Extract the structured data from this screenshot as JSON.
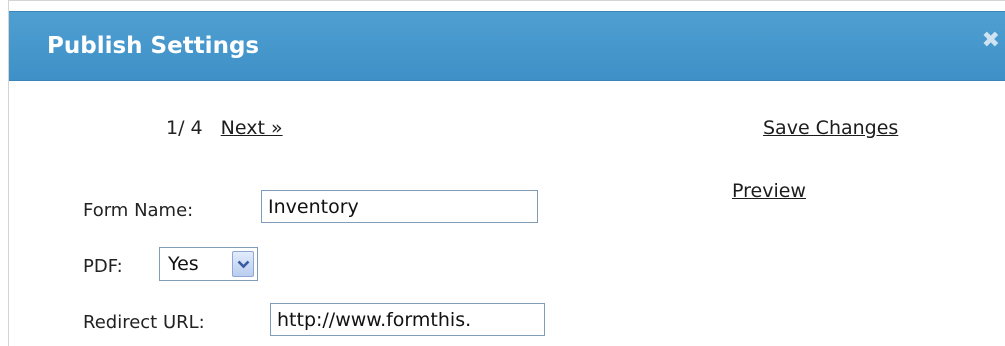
{
  "dialog": {
    "title": "Publish Settings",
    "close_label": "✖"
  },
  "pager": {
    "count": "1/ 4",
    "next_label": "Next »"
  },
  "actions": {
    "save_label": "Save Changes",
    "preview_label": "Preview"
  },
  "form": {
    "form_name": {
      "label": "Form Name:",
      "value": "Inventory"
    },
    "pdf": {
      "label": "PDF:",
      "selected": "Yes"
    },
    "redirect_url": {
      "label": "Redirect URL:",
      "value": "http://www.formthis."
    }
  },
  "colors": {
    "titlebar": "#4f9fd2",
    "title_text": "#ffffff",
    "input_border": "#7f9db9"
  }
}
